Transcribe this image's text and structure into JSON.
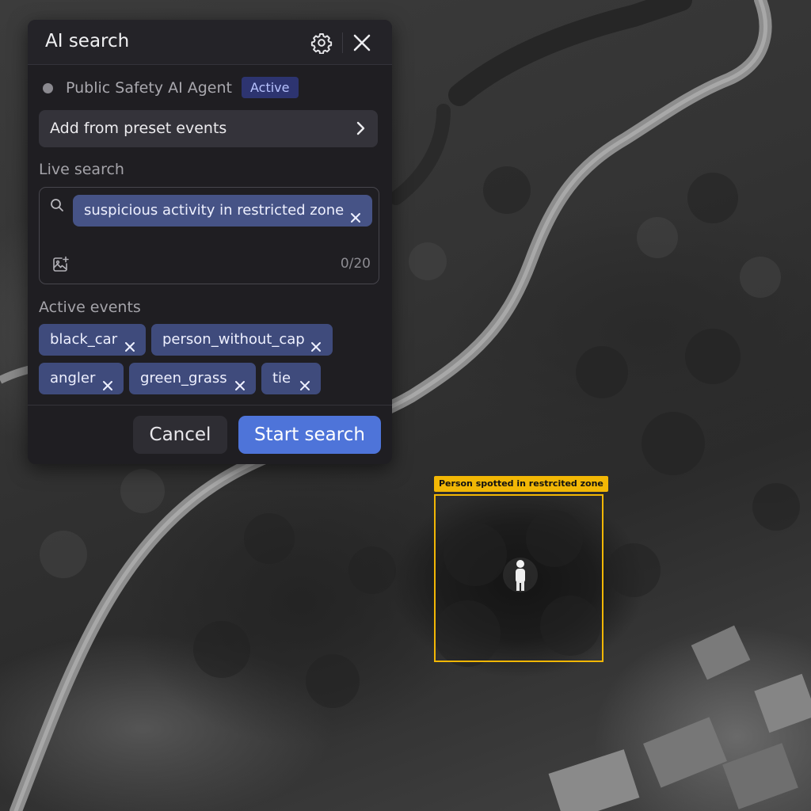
{
  "panel": {
    "title": "AI search",
    "settings_icon": "gear-icon",
    "close_icon": "close-icon"
  },
  "agent": {
    "name": "Public Safety AI Agent",
    "status": "Active"
  },
  "preset": {
    "label": "Add from preset events",
    "icon": "chevron-right-icon"
  },
  "live_search": {
    "label": "Live search",
    "query": "suspicious activity in restricted zone",
    "counter": "0/20",
    "search_icon": "search-icon",
    "add_image_icon": "image-add-icon"
  },
  "active_events": {
    "label": "Active events",
    "items": [
      "black_car",
      "person_without_cap",
      "angler",
      "green_grass",
      "tie"
    ]
  },
  "footer": {
    "cancel": "Cancel",
    "start": "Start search"
  },
  "detection": {
    "label": "Person spotted in restrcited zone"
  },
  "colors": {
    "accent": "#4e74d9",
    "chip": "#3f4b7c",
    "badge_bg": "#2d3470",
    "detection": "#f2b705"
  }
}
